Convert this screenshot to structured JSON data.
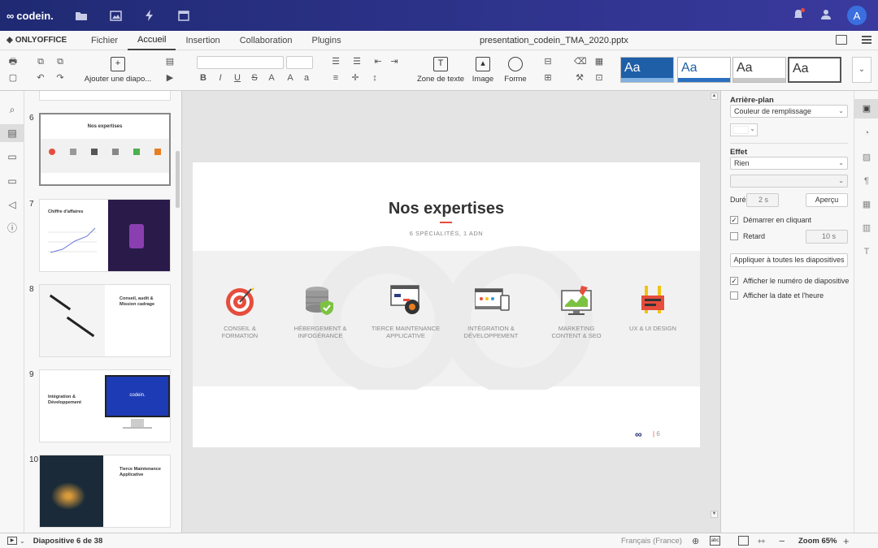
{
  "brand": {
    "logo": "codein.",
    "onlyoffice": "ONLYOFFICE",
    "avatar": "A"
  },
  "menu": {
    "tabs": [
      "Fichier",
      "Accueil",
      "Insertion",
      "Collaboration",
      "Plugins"
    ],
    "active": "Accueil",
    "filename": "presentation_codein_TMA_2020.pptx"
  },
  "toolbar": {
    "add_slide": "Ajouter une diapo...",
    "text_box": "Zone de texte",
    "image": "Image",
    "shape": "Forme",
    "theme_label": "Aa"
  },
  "thumbnails": [
    {
      "num": "6",
      "title": "Nos expertises"
    },
    {
      "num": "7",
      "title": "Chiffre d'affaires"
    },
    {
      "num": "8",
      "title": "Conseil, audit & Mission cadrage"
    },
    {
      "num": "9",
      "title": "Intégration & Développement",
      "screen_text": "codein."
    },
    {
      "num": "10",
      "title": "Tierce Maintenance Applicative"
    }
  ],
  "slide": {
    "title": "Nos expertises",
    "subtitle": "6 SPÉCIALITÉS, 1 ADN",
    "page": "6",
    "expertises": [
      {
        "line1": "CONSEIL &",
        "line2": "FORMATION",
        "icon": "target-icon"
      },
      {
        "line1": "HÉBERGEMENT &",
        "line2": "INFOGÉRANCE",
        "icon": "database-shield-icon"
      },
      {
        "line1": "TIERCE MAINTENANCE",
        "line2": "APPLICATIVE",
        "icon": "gear-window-icon"
      },
      {
        "line1": "INTÉGRATION &",
        "line2": "DÉVELOPPEMENT",
        "icon": "devices-icon"
      },
      {
        "line1": "MARKETING",
        "line2": "CONTENT & SEO",
        "icon": "monitor-rocket-icon"
      },
      {
        "line1": "UX & UI DESIGN",
        "line2": "",
        "icon": "design-icon"
      }
    ]
  },
  "panel": {
    "background_title": "Arrière-plan",
    "fill_value": "Couleur de remplissage",
    "effect_title": "Effet",
    "effect_value": "Rien",
    "duration_label": "Durée",
    "duration_value": "2 s",
    "preview_button": "Aperçu",
    "start_on_click": "Démarrer en cliquant",
    "delay_label": "Retard",
    "delay_value": "10 s",
    "apply_all": "Appliquer à toutes les diapositives",
    "show_number": "Afficher le numéro de diapositive",
    "show_date": "Afficher la date et l'heure"
  },
  "status": {
    "slide_of": "Diapositive 6 de 38",
    "language": "Français (France)",
    "zoom": "Zoom 65%"
  }
}
